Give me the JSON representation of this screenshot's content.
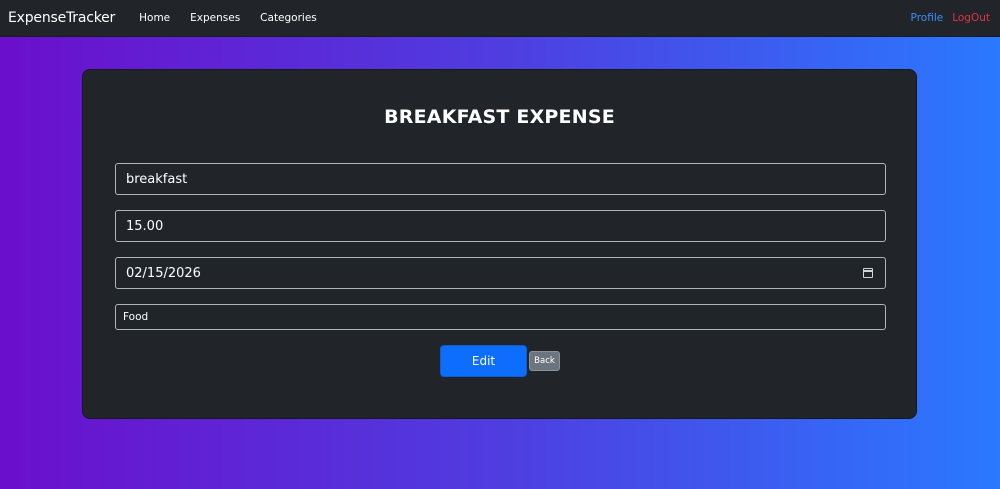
{
  "navbar": {
    "brand": "ExpenseTracker",
    "links": [
      "Home",
      "Expenses",
      "Categories"
    ],
    "profile": "Profile",
    "logout": "LogOut"
  },
  "form": {
    "title": "BREAKFAST EXPENSE",
    "name_value": "breakfast",
    "amount_value": "15.00",
    "date_value": "02/15/2026",
    "category_value": "Food",
    "edit_label": "Edit",
    "back_label": "Back"
  },
  "colors": {
    "navbar": "#212529",
    "card": "#212529",
    "primary": "#0d6efd",
    "secondary": "#6c757d",
    "profile_link": "#3d8bfd",
    "logout_link": "#dc3545",
    "gradient_start": "#6b0fcc",
    "gradient_end": "#2a79ff"
  },
  "icons": {
    "date_picker": "calendar-icon"
  }
}
